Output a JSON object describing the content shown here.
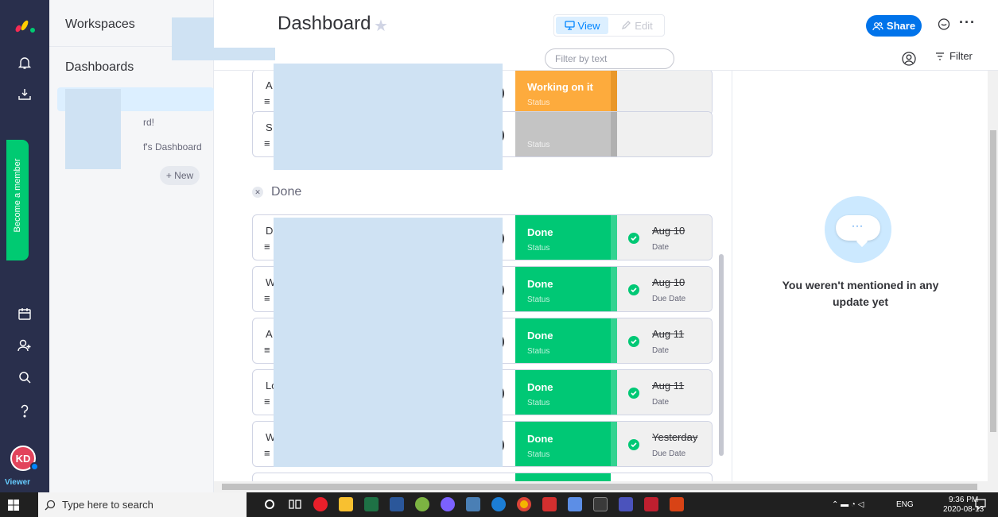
{
  "rail": {
    "become_member": "Become a member",
    "avatar_initials": "KD",
    "viewer_label": "Viewer"
  },
  "panel": {
    "workspaces_title": "Workspaces",
    "dashboards_title": "Dashboards",
    "item1_suffix": "rd!",
    "item2_suffix": "f's Dashboard",
    "new_button": "+ New"
  },
  "header": {
    "title": "Dashboard",
    "view_label": "View",
    "edit_label": "Edit",
    "share_label": "Share",
    "filter_placeholder": "Filter by text",
    "filter_label": "Filter"
  },
  "board": {
    "top_cards": [
      {
        "letter": "A",
        "status": "Working on it",
        "status_label": "Status",
        "color": "#fdab3d"
      },
      {
        "letter": "S",
        "status": "",
        "status_label": "Status",
        "color": "#c4c4c4"
      }
    ],
    "group_title": "Done",
    "done_cards": [
      {
        "letter": "D",
        "status": "Done",
        "status_label": "Status",
        "date": "Aug 10",
        "date_label": "Date"
      },
      {
        "letter": "W",
        "status": "Done",
        "status_label": "Status",
        "date": "Aug 10",
        "date_label": "Due Date"
      },
      {
        "letter": "A",
        "status": "Done",
        "status_label": "Status",
        "date": "Aug 11",
        "date_label": "Date"
      },
      {
        "letter": "Lo",
        "status": "Done",
        "status_label": "Status",
        "date": "Aug 11",
        "date_label": "Date"
      },
      {
        "letter": "W",
        "status": "Done",
        "status_label": "Status",
        "date": "Yesterday",
        "date_label": "Due Date"
      }
    ]
  },
  "updates": {
    "empty_message": "You weren't mentioned in any update yet"
  },
  "taskbar": {
    "search_placeholder": "Type here to search",
    "language": "ENG",
    "time": "9:36 PM",
    "date": "2020-08-13"
  },
  "colors": {
    "done": "#00c875",
    "working": "#fdab3d",
    "accent": "#0073ea",
    "rail": "#292f4c"
  }
}
